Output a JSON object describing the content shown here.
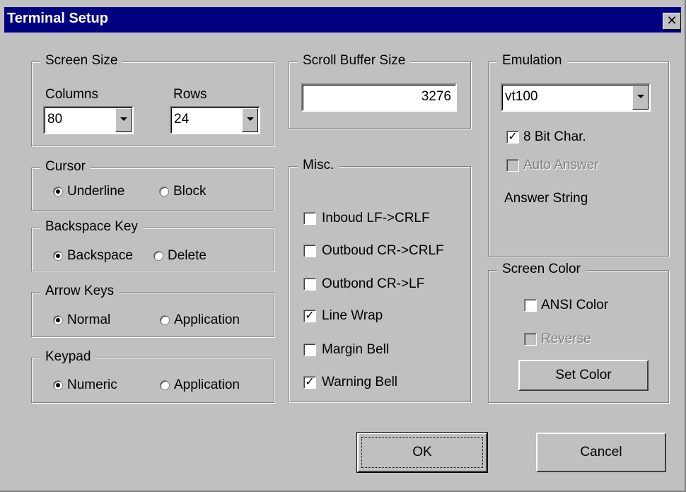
{
  "window": {
    "title": "Terminal Setup"
  },
  "screen_size": {
    "label": "Screen Size",
    "columns_label": "Columns",
    "columns_value": "80",
    "rows_label": "Rows",
    "rows_value": "24"
  },
  "cursor": {
    "label": "Cursor",
    "underline": "Underline",
    "block": "Block",
    "selected": "Underline"
  },
  "backspace_key": {
    "label": "Backspace Key",
    "backspace": "Backspace",
    "delete": "Delete",
    "selected": "Backspace"
  },
  "arrow_keys": {
    "label": "Arrow Keys",
    "normal": "Normal",
    "application": "Application",
    "selected": "Normal"
  },
  "keypad": {
    "label": "Keypad",
    "numeric": "Numeric",
    "application": "Application",
    "selected": "Numeric"
  },
  "scroll_buffer": {
    "label": "Scroll Buffer Size",
    "value": "3276"
  },
  "misc": {
    "label": "Misc.",
    "items": [
      {
        "label": "Inboud LF->CRLF",
        "checked": false
      },
      {
        "label": "Outboud CR->CRLF",
        "checked": false
      },
      {
        "label": "Outbond CR->LF",
        "checked": false
      },
      {
        "label": "Line Wrap",
        "checked": true
      },
      {
        "label": "Margin Bell",
        "checked": false
      },
      {
        "label": "Warning Bell",
        "checked": true
      }
    ]
  },
  "emulation": {
    "label": "Emulation",
    "value": "vt100",
    "eight_bit": "8 Bit Char.",
    "auto_answer": "Auto Answer",
    "answer_string": "Answer String"
  },
  "screen_color": {
    "label": "Screen Color",
    "ansi": "ANSI Color",
    "reverse": "Reverse",
    "set_color": "Set Color"
  },
  "buttons": {
    "ok": "OK",
    "cancel": "Cancel"
  },
  "icons": {
    "close": "close-icon",
    "dropdown": "chevron-down-icon",
    "check": "checkmark-icon"
  },
  "colors": {
    "titlebar": "#000080",
    "face": "#c0c0c0"
  }
}
